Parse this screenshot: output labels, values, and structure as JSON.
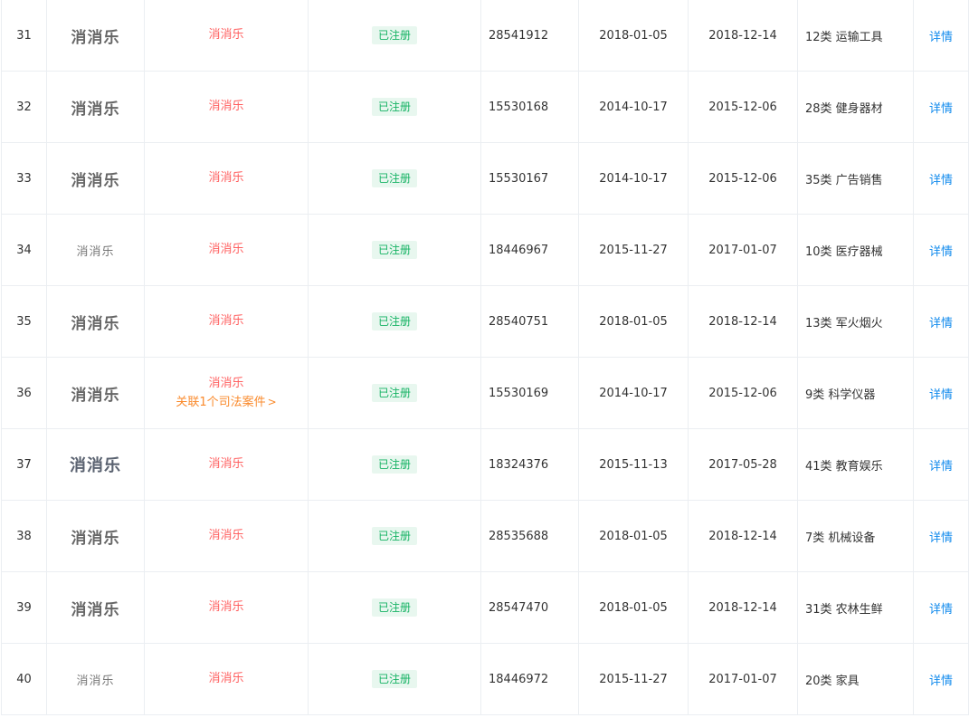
{
  "status_color": "#16b364",
  "name_color": "#ff5f5f",
  "link_color": "#128bed",
  "rows": [
    {
      "index": "31",
      "logo": "消消乐",
      "logo_style": "normal",
      "name": "消消乐",
      "judicial": "",
      "status": "已注册",
      "apply_no": "28541912",
      "apply_date": "2018-01-05",
      "reg_date": "2018-12-14",
      "class": "12类 运输工具",
      "action": "详情"
    },
    {
      "index": "32",
      "logo": "消消乐",
      "logo_style": "normal",
      "name": "消消乐",
      "judicial": "",
      "status": "已注册",
      "apply_no": "15530168",
      "apply_date": "2014-10-17",
      "reg_date": "2015-12-06",
      "class": "28类 健身器材",
      "action": "详情"
    },
    {
      "index": "33",
      "logo": "消消乐",
      "logo_style": "normal",
      "name": "消消乐",
      "judicial": "",
      "status": "已注册",
      "apply_no": "15530167",
      "apply_date": "2014-10-17",
      "reg_date": "2015-12-06",
      "class": "35类 广告销售",
      "action": "详情"
    },
    {
      "index": "34",
      "logo": "消消乐",
      "logo_style": "small",
      "name": "消消乐",
      "judicial": "",
      "status": "已注册",
      "apply_no": "18446967",
      "apply_date": "2015-11-27",
      "reg_date": "2017-01-07",
      "class": "10类 医疗器械",
      "action": "详情"
    },
    {
      "index": "35",
      "logo": "消消乐",
      "logo_style": "normal",
      "name": "消消乐",
      "judicial": "",
      "status": "已注册",
      "apply_no": "28540751",
      "apply_date": "2018-01-05",
      "reg_date": "2018-12-14",
      "class": "13类 军火烟火",
      "action": "详情"
    },
    {
      "index": "36",
      "logo": "消消乐",
      "logo_style": "normal",
      "name": "消消乐",
      "judicial": "关联1个司法案件",
      "status": "已注册",
      "apply_no": "15530169",
      "apply_date": "2014-10-17",
      "reg_date": "2015-12-06",
      "class": "9类 科学仪器",
      "action": "详情"
    },
    {
      "index": "37",
      "logo": "消消乐",
      "logo_style": "large",
      "name": "消消乐",
      "judicial": "",
      "status": "已注册",
      "apply_no": "18324376",
      "apply_date": "2015-11-13",
      "reg_date": "2017-05-28",
      "class": "41类 教育娱乐",
      "action": "详情"
    },
    {
      "index": "38",
      "logo": "消消乐",
      "logo_style": "normal",
      "name": "消消乐",
      "judicial": "",
      "status": "已注册",
      "apply_no": "28535688",
      "apply_date": "2018-01-05",
      "reg_date": "2018-12-14",
      "class": "7类 机械设备",
      "action": "详情"
    },
    {
      "index": "39",
      "logo": "消消乐",
      "logo_style": "normal",
      "name": "消消乐",
      "judicial": "",
      "status": "已注册",
      "apply_no": "28547470",
      "apply_date": "2018-01-05",
      "reg_date": "2018-12-14",
      "class": "31类 农林生鲜",
      "action": "详情"
    },
    {
      "index": "40",
      "logo": "消消乐",
      "logo_style": "small",
      "name": "消消乐",
      "judicial": "",
      "status": "已注册",
      "apply_no": "18446972",
      "apply_date": "2015-11-27",
      "reg_date": "2017-01-07",
      "class": "20类 家具",
      "action": "详情"
    }
  ]
}
